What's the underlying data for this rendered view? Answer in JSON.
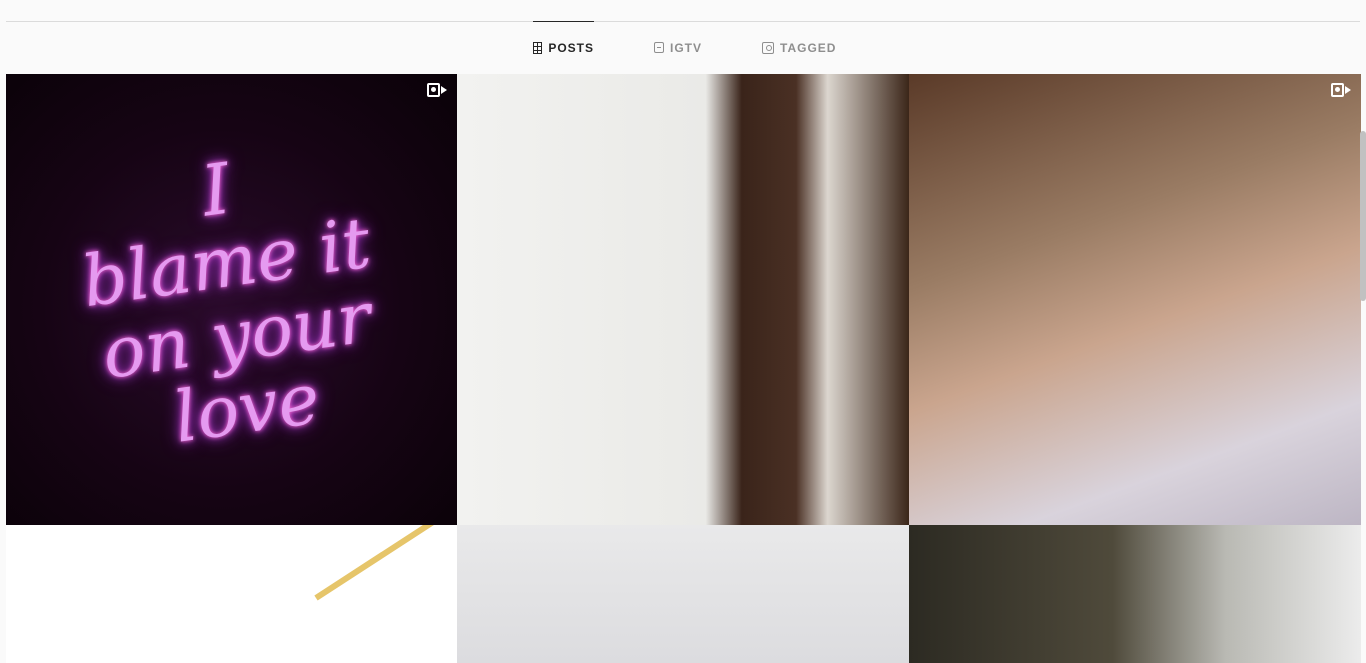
{
  "tabs": [
    {
      "label": "POSTS",
      "icon": "grid-icon",
      "active": true
    },
    {
      "label": "IGTV",
      "icon": "tv-icon",
      "active": false
    },
    {
      "label": "TAGGED",
      "icon": "tag-icon",
      "active": false
    }
  ],
  "posts": [
    {
      "type": "video",
      "caption_lines": [
        "I",
        "blame it",
        "on your",
        "love"
      ]
    },
    {
      "type": "image"
    },
    {
      "type": "video"
    },
    {
      "type": "image"
    },
    {
      "type": "image"
    },
    {
      "type": "image"
    }
  ],
  "colors": {
    "active_tab": "#262626",
    "inactive_tab": "#8e8e8e",
    "background": "#fafafa"
  }
}
